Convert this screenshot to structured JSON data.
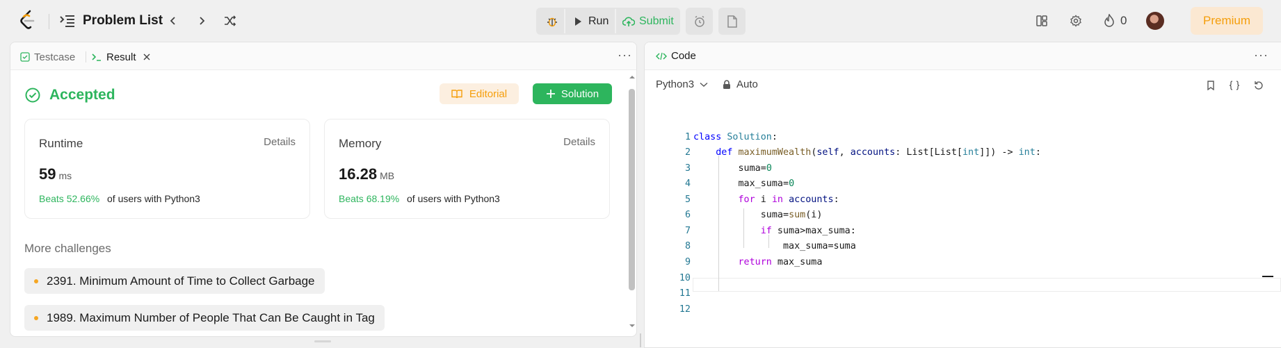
{
  "topbar": {
    "title": "Problem List",
    "run_label": "Run",
    "submit_label": "Submit",
    "streak_count": "0",
    "premium_label": "Premium"
  },
  "left_panel": {
    "tabs": [
      {
        "label": "Testcase"
      },
      {
        "label": "Result"
      }
    ],
    "status": "Accepted",
    "editorial_label": "Editorial",
    "solution_label": "Solution",
    "runtime": {
      "label": "Runtime",
      "details": "Details",
      "value": "59",
      "unit": "ms",
      "beats": "Beats 52.66%",
      "suffix": "of users with Python3"
    },
    "memory": {
      "label": "Memory",
      "details": "Details",
      "value": "16.28",
      "unit": "MB",
      "beats": "Beats 68.19%",
      "suffix": "of users with Python3"
    },
    "more_challenges_title": "More challenges",
    "challenges": [
      {
        "title": "2391. Minimum Amount of Time to Collect Garbage"
      },
      {
        "title": "1989. Maximum Number of People That Can Be Caught in Tag"
      }
    ]
  },
  "code_panel": {
    "title": "Code",
    "language": "Python3",
    "mode": "Auto",
    "line_numbers": [
      "1",
      "2",
      "3",
      "4",
      "5",
      "6",
      "7",
      "8",
      "9",
      "10",
      "11",
      "12"
    ],
    "code_lines": [
      "class Solution:",
      "    def maximumWealth(self, accounts: List[List[int]]) -> int:",
      "        suma=0",
      "        max_suma=0",
      "        for i in accounts:",
      "            suma=sum(i)",
      "            if suma>max_suma:",
      "                max_suma=suma",
      "        return max_suma",
      "",
      "",
      ""
    ]
  },
  "colors": {
    "accent_green": "#2db55d",
    "premium_orange": "#f59e0b",
    "link_number": "#237893"
  },
  "icons": [
    "leetcode-logo",
    "list-icon",
    "chevron-left-icon",
    "chevron-right-icon",
    "shuffle-icon",
    "debug-icon",
    "play-icon",
    "cloud-upload-icon",
    "alarm-icon",
    "note-icon",
    "layout-icon",
    "gear-icon",
    "fire-icon",
    "check-circle-icon",
    "book-icon",
    "plus-icon",
    "terminal-icon",
    "close-icon",
    "code-icon",
    "lock-icon",
    "bookmark-icon",
    "braces-icon",
    "reset-icon"
  ]
}
